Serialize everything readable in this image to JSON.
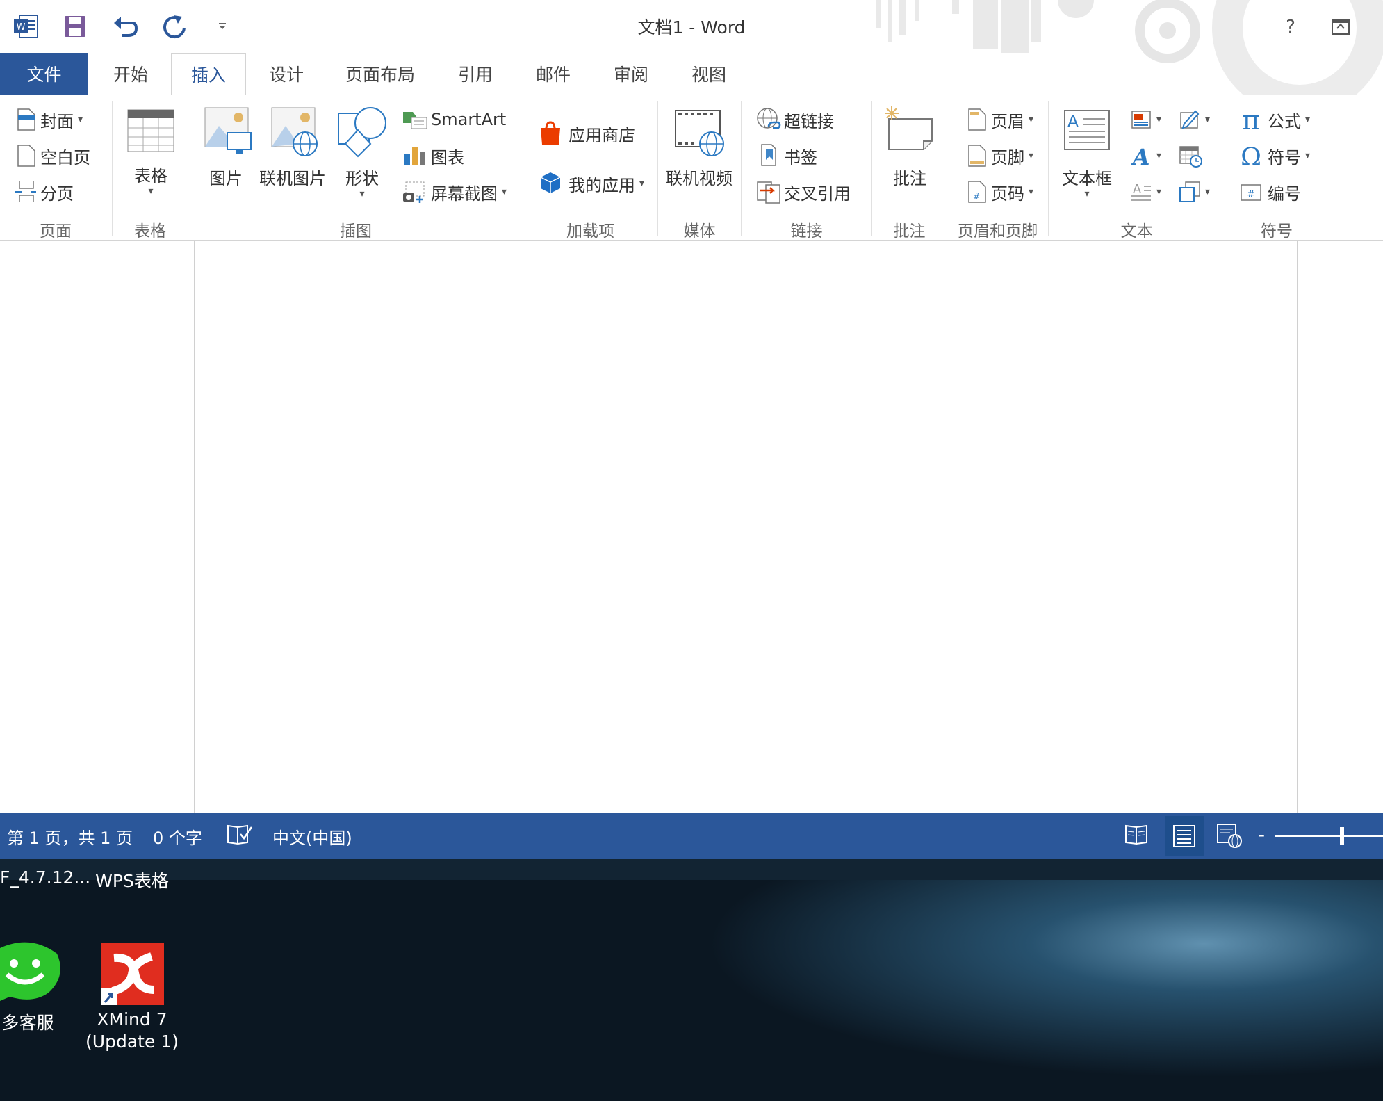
{
  "window": {
    "title": "文档1 - Word",
    "help": "?"
  },
  "tabs": [
    "文件",
    "开始",
    "插入",
    "设计",
    "页面布局",
    "引用",
    "邮件",
    "审阅",
    "视图"
  ],
  "active_tab": "插入",
  "ribbon": {
    "pages": {
      "cover": "封面",
      "blank": "空白页",
      "break": "分页",
      "label": "页面"
    },
    "table": {
      "table": "表格",
      "label": "表格"
    },
    "illustrations": {
      "picture": "图片",
      "online_picture": "联机图片",
      "shapes": "形状",
      "smartart": "SmartArt",
      "chart": "图表",
      "screenshot": "屏幕截图",
      "label": "插图"
    },
    "addins": {
      "store": "应用商店",
      "myapps": "我的应用",
      "label": "加载项"
    },
    "media": {
      "video": "联机视频",
      "label": "媒体"
    },
    "links": {
      "hyperlink": "超链接",
      "bookmark": "书签",
      "crossref": "交叉引用",
      "label": "链接"
    },
    "comments": {
      "comment": "批注",
      "label": "批注"
    },
    "header_footer": {
      "header": "页眉",
      "footer": "页脚",
      "pagenum": "页码",
      "label": "页眉和页脚"
    },
    "text": {
      "textbox": "文本框",
      "label": "文本"
    },
    "symbols": {
      "equation": "公式",
      "symbol": "符号",
      "number": "编号",
      "label": "符号"
    }
  },
  "status": {
    "page": "第 1 页，共 1 页",
    "words": "0 个字",
    "language": "中文(中国)"
  },
  "desktop": {
    "icon1": "F_4.7.12...",
    "icon2": "WPS表格",
    "icon3": "多客服",
    "icon4_line1": "XMind 7",
    "icon4_line2": "(Update 1)"
  },
  "colors": {
    "accent": "#2b579a",
    "desktop": "#0b1722"
  }
}
